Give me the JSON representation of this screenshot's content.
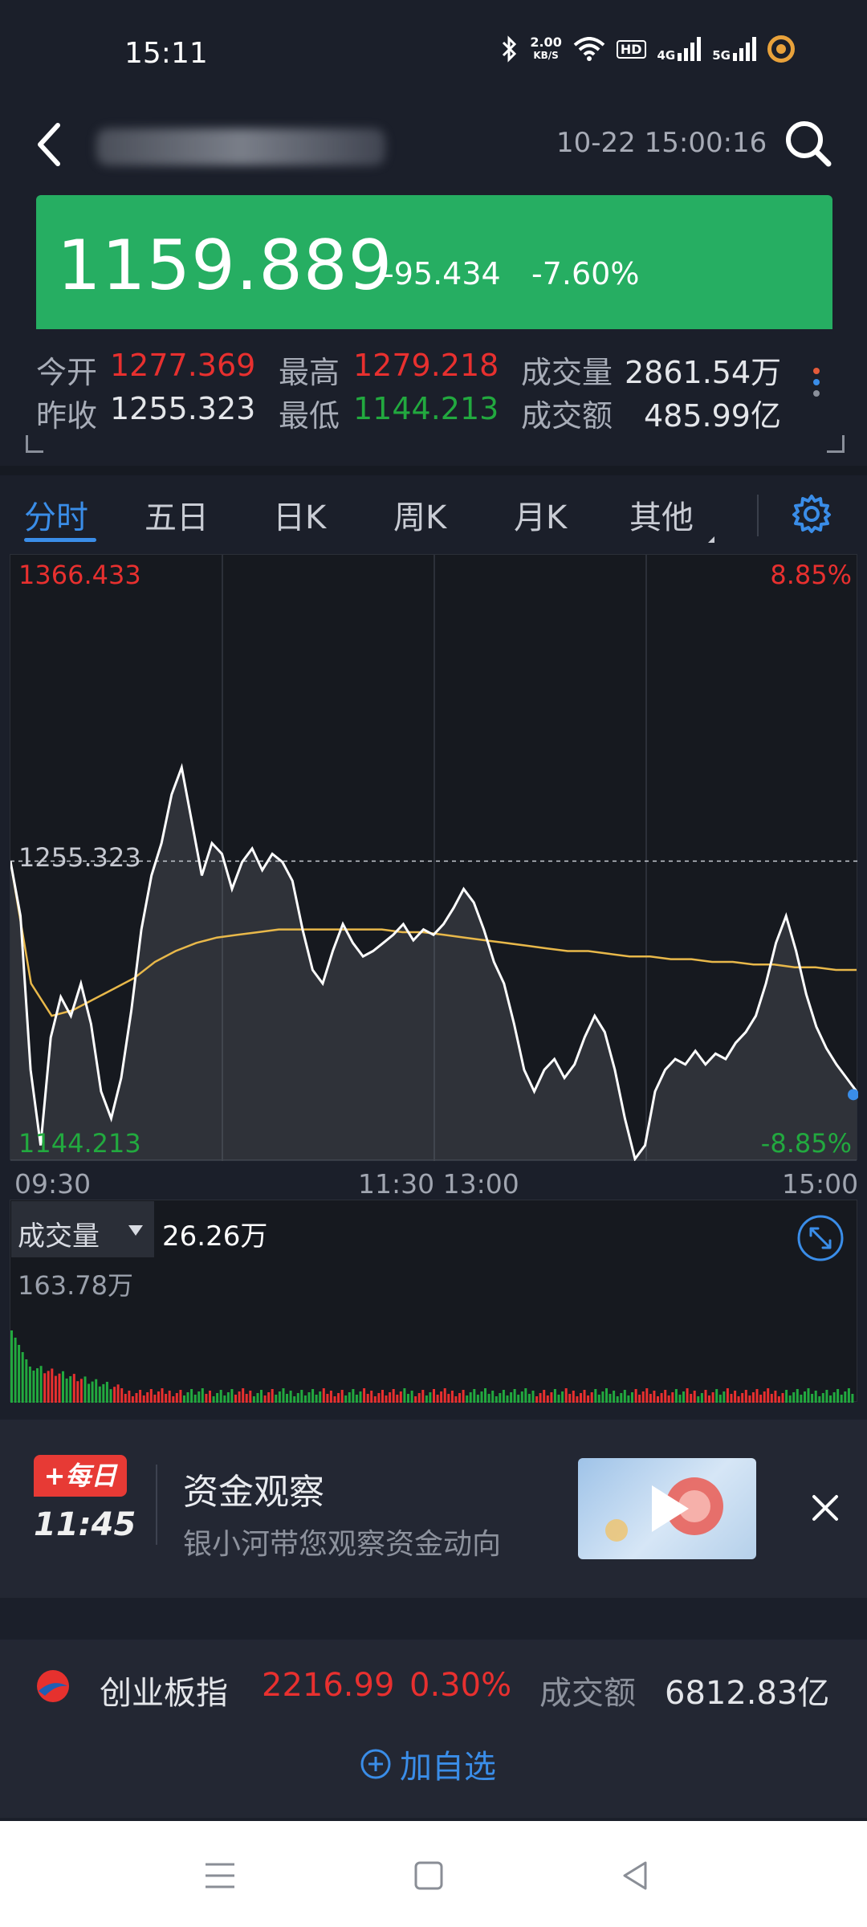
{
  "status_bar": {
    "time": "15:11",
    "net_speed_value": "2.00",
    "net_speed_unit": "KB/S",
    "hd_label": "HD",
    "sig1_label": "4G",
    "sig2_label": "5G"
  },
  "header": {
    "datetime": "10-22 15:00:16"
  },
  "quote": {
    "price": "1159.889",
    "change": "-95.434",
    "change_pct": "-7.60%",
    "open_label": "今开",
    "open": "1277.369",
    "high_label": "最高",
    "high": "1279.218",
    "volume_label": "成交量",
    "volume": "2861.54万",
    "prev_close_label": "昨收",
    "prev_close": "1255.323",
    "low_label": "最低",
    "low": "1144.213",
    "amount_label": "成交额",
    "amount": "485.99亿"
  },
  "tabs": [
    {
      "label": "分时",
      "active": true
    },
    {
      "label": "五日"
    },
    {
      "label": "日K"
    },
    {
      "label": "周K"
    },
    {
      "label": "月K"
    },
    {
      "label": "其他"
    }
  ],
  "chart": {
    "y_max": "1366.433",
    "y_mid": "1255.323",
    "y_min": "1144.213",
    "pct_max": "8.85%",
    "pct_min": "-8.85%",
    "time_start": "09:30",
    "time_mid": "11:30 13:00",
    "time_end": "15:00"
  },
  "chart_data": {
    "type": "line",
    "title": "",
    "ylim": [
      1144.213,
      1366.433
    ],
    "reference": 1255.323,
    "series": [
      {
        "values": [
          1255.3,
          1235,
          1178,
          1150,
          1190,
          1205,
          1198,
          1210,
          1195,
          1170,
          1160,
          1175,
          1200,
          1230,
          1250,
          1262,
          1280,
          1290,
          1270,
          1250,
          1262,
          1258,
          1245,
          1255,
          1260,
          1252,
          1258,
          1255,
          1248,
          1230,
          1215,
          1210,
          1222,
          1232,
          1225,
          1220,
          1222,
          1225,
          1228,
          1232,
          1226,
          1230,
          1228,
          1232,
          1238,
          1245,
          1240,
          1230,
          1218,
          1210,
          1195,
          1178,
          1170,
          1178,
          1182,
          1175,
          1180,
          1190,
          1198,
          1192,
          1178,
          1160,
          1145,
          1150,
          1170,
          1178,
          1182,
          1180,
          1185,
          1180,
          1184,
          1182,
          1188,
          1192,
          1198,
          1210,
          1225,
          1235,
          1222,
          1206,
          1194,
          1186,
          1180,
          1175,
          1170
        ],
        "color": "#ffffff"
      },
      {
        "values": [
          1255.3,
          1210,
          1198,
          1200,
          1204,
          1208,
          1212,
          1218,
          1222,
          1225,
          1227,
          1228,
          1229,
          1230,
          1230,
          1230,
          1230,
          1230,
          1230,
          1229,
          1229,
          1228,
          1227,
          1226,
          1225,
          1224,
          1223,
          1222,
          1222,
          1221,
          1220,
          1220,
          1219,
          1219,
          1218,
          1218,
          1217,
          1217,
          1216,
          1216,
          1215,
          1215
        ],
        "color": "#e8b84a"
      }
    ]
  },
  "volume": {
    "label": "成交量",
    "value": "26.26万",
    "max": "163.78万"
  },
  "ad": {
    "logo_top": "+每日",
    "logo_time": "11:45",
    "title": "资金观察",
    "subtitle": "银小河带您观察资金动向"
  },
  "ticker": {
    "name": "创业板指",
    "price": "2216.99",
    "pct": "0.30%",
    "amount_label": "成交额",
    "amount": "6812.83亿",
    "add_watch": "加自选"
  }
}
